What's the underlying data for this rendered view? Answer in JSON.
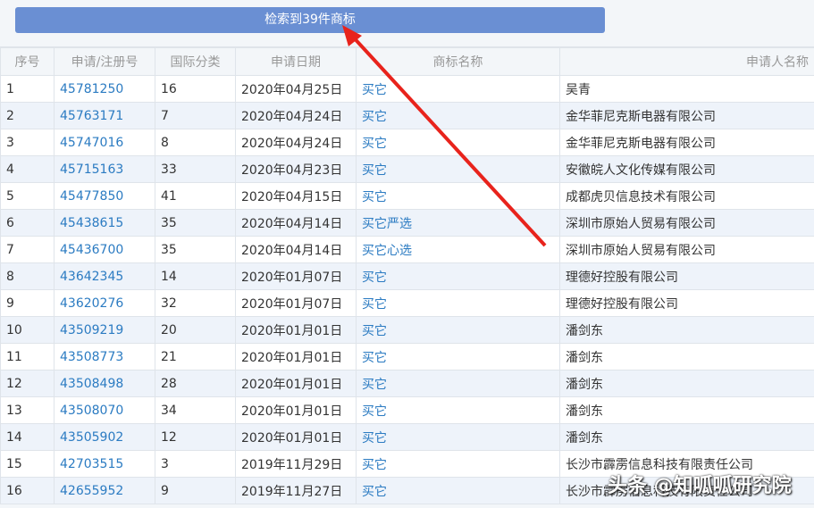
{
  "result_label": "检索到39件商标",
  "columns": [
    "序号",
    "申请/注册号",
    "国际分类",
    "申请日期",
    "商标名称",
    "申请人名称"
  ],
  "rows": [
    [
      "1",
      "45781250",
      "16",
      "2020年04月25日",
      "买它",
      "吴青"
    ],
    [
      "2",
      "45763171",
      "7",
      "2020年04月24日",
      "买它",
      "金华菲尼克斯电器有限公司"
    ],
    [
      "3",
      "45747016",
      "8",
      "2020年04月24日",
      "买它",
      "金华菲尼克斯电器有限公司"
    ],
    [
      "4",
      "45715163",
      "33",
      "2020年04月23日",
      "买它",
      "安徽皖人文化传媒有限公司"
    ],
    [
      "5",
      "45477850",
      "41",
      "2020年04月15日",
      "买它",
      "成都虎贝信息技术有限公司"
    ],
    [
      "6",
      "45438615",
      "35",
      "2020年04月14日",
      "买它严选",
      "深圳市原始人贸易有限公司"
    ],
    [
      "7",
      "45436700",
      "35",
      "2020年04月14日",
      "买它心选",
      "深圳市原始人贸易有限公司"
    ],
    [
      "8",
      "43642345",
      "14",
      "2020年01月07日",
      "买它",
      "理德好控股有限公司"
    ],
    [
      "9",
      "43620276",
      "32",
      "2020年01月07日",
      "买它",
      "理德好控股有限公司"
    ],
    [
      "10",
      "43509219",
      "20",
      "2020年01月01日",
      "买它",
      "潘剑东"
    ],
    [
      "11",
      "43508773",
      "21",
      "2020年01月01日",
      "买它",
      "潘剑东"
    ],
    [
      "12",
      "43508498",
      "28",
      "2020年01月01日",
      "买它",
      "潘剑东"
    ],
    [
      "13",
      "43508070",
      "34",
      "2020年01月01日",
      "买它",
      "潘剑东"
    ],
    [
      "14",
      "43505902",
      "12",
      "2020年01月01日",
      "买它",
      "潘剑东"
    ],
    [
      "15",
      "42703515",
      "3",
      "2019年11月29日",
      "买它",
      "长沙市霹雳信息科技有限责任公司"
    ],
    [
      "16",
      "42655952",
      "9",
      "2019年11月27日",
      "买它",
      "长沙市霹雳信息科技有限责任公司"
    ]
  ],
  "watermark": "头条 @知呱呱研究院",
  "colors": {
    "accent": "#6a8fd3",
    "link": "#2b7bc2",
    "arrow": "#e8231c"
  }
}
